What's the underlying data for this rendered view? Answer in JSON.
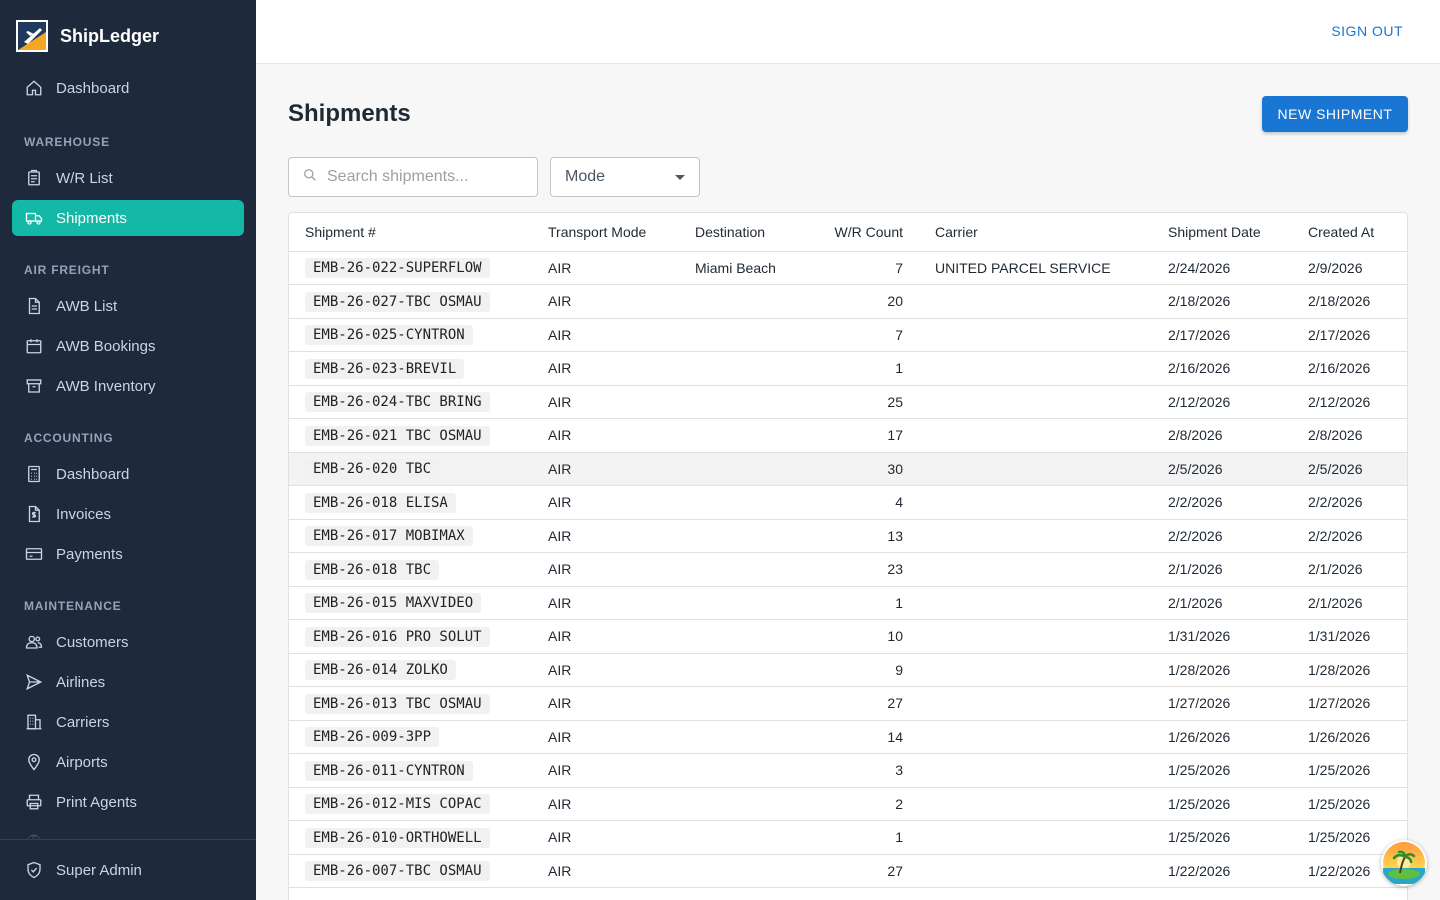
{
  "app": {
    "name": "ShipLedger"
  },
  "header": {
    "sign_out": "SIGN OUT"
  },
  "sidebar": {
    "items": [
      {
        "label": "Dashboard",
        "icon": "home-icon"
      },
      {
        "section": "WAREHOUSE"
      },
      {
        "label": "W/R List",
        "icon": "clipboard-icon"
      },
      {
        "label": "Shipments",
        "icon": "truck-icon",
        "active": true
      },
      {
        "section": "AIR FREIGHT"
      },
      {
        "label": "AWB List",
        "icon": "document-icon"
      },
      {
        "label": "AWB Bookings",
        "icon": "calendar-icon"
      },
      {
        "label": "AWB Inventory",
        "icon": "archive-icon"
      },
      {
        "section": "ACCOUNTING"
      },
      {
        "label": "Dashboard",
        "icon": "calculator-icon"
      },
      {
        "label": "Invoices",
        "icon": "invoice-icon"
      },
      {
        "label": "Payments",
        "icon": "credit-card-icon"
      },
      {
        "section": "MAINTENANCE"
      },
      {
        "label": "Customers",
        "icon": "users-icon"
      },
      {
        "label": "Airlines",
        "icon": "paper-plane-icon"
      },
      {
        "label": "Carriers",
        "icon": "building-icon"
      },
      {
        "label": "Airports",
        "icon": "location-pin-icon"
      },
      {
        "label": "Print Agents",
        "icon": "printer-icon"
      }
    ],
    "bottom": {
      "label": "Super Admin",
      "icon": "shield-icon"
    }
  },
  "main": {
    "title": "Shipments",
    "new_button": "NEW SHIPMENT",
    "search": {
      "placeholder": "Search shipments..."
    },
    "mode_filter": {
      "value": "Mode"
    },
    "table": {
      "columns": [
        "Shipment #",
        "Transport Mode",
        "Destination",
        "W/R Count",
        "Carrier",
        "Shipment Date",
        "Created At"
      ],
      "rows": [
        [
          "EMB-26-022-SUPERFLOW",
          "AIR",
          "Miami Beach",
          "7",
          "UNITED PARCEL SERVICE",
          "2/24/2026",
          "2/9/2026"
        ],
        [
          "EMB-26-027-TBC OSMAU",
          "AIR",
          "",
          "20",
          "",
          "2/18/2026",
          "2/18/2026"
        ],
        [
          "EMB-26-025-CYNTRON",
          "AIR",
          "",
          "7",
          "",
          "2/17/2026",
          "2/17/2026"
        ],
        [
          "EMB-26-023-BREVIL",
          "AIR",
          "",
          "1",
          "",
          "2/16/2026",
          "2/16/2026"
        ],
        [
          "EMB-26-024-TBC BRING",
          "AIR",
          "",
          "25",
          "",
          "2/12/2026",
          "2/12/2026"
        ],
        [
          "EMB-26-021 TBC OSMAU",
          "AIR",
          "",
          "17",
          "",
          "2/8/2026",
          "2/8/2026"
        ],
        [
          "EMB-26-020 TBC",
          "AIR",
          "",
          "30",
          "",
          "2/5/2026",
          "2/5/2026"
        ],
        [
          "EMB-26-018 ELISA",
          "AIR",
          "",
          "4",
          "",
          "2/2/2026",
          "2/2/2026"
        ],
        [
          "EMB-26-017 MOBIMAX",
          "AIR",
          "",
          "13",
          "",
          "2/2/2026",
          "2/2/2026"
        ],
        [
          "EMB-26-018 TBC",
          "AIR",
          "",
          "23",
          "",
          "2/1/2026",
          "2/1/2026"
        ],
        [
          "EMB-26-015 MAXVIDEO",
          "AIR",
          "",
          "1",
          "",
          "2/1/2026",
          "2/1/2026"
        ],
        [
          "EMB-26-016 PRO SOLUT",
          "AIR",
          "",
          "10",
          "",
          "1/31/2026",
          "1/31/2026"
        ],
        [
          "EMB-26-014 ZOLKO",
          "AIR",
          "",
          "9",
          "",
          "1/28/2026",
          "1/28/2026"
        ],
        [
          "EMB-26-013 TBC OSMAU",
          "AIR",
          "",
          "27",
          "",
          "1/27/2026",
          "1/27/2026"
        ],
        [
          "EMB-26-009-3PP",
          "AIR",
          "",
          "14",
          "",
          "1/26/2026",
          "1/26/2026"
        ],
        [
          "EMB-26-011-CYNTRON",
          "AIR",
          "",
          "3",
          "",
          "1/25/2026",
          "1/25/2026"
        ],
        [
          "EMB-26-012-MIS COPAC",
          "AIR",
          "",
          "2",
          "",
          "1/25/2026",
          "1/25/2026"
        ],
        [
          "EMB-26-010-ORTHOWELL",
          "AIR",
          "",
          "1",
          "",
          "1/25/2026",
          "1/25/2026"
        ],
        [
          "EMB-26-007-TBC OSMAU",
          "AIR",
          "",
          "27",
          "",
          "1/22/2026",
          "1/22/2026"
        ]
      ]
    }
  },
  "colors": {
    "sidebar_bg": "#1e293b",
    "active_item": "#14b8a6",
    "primary": "#1976d2"
  }
}
